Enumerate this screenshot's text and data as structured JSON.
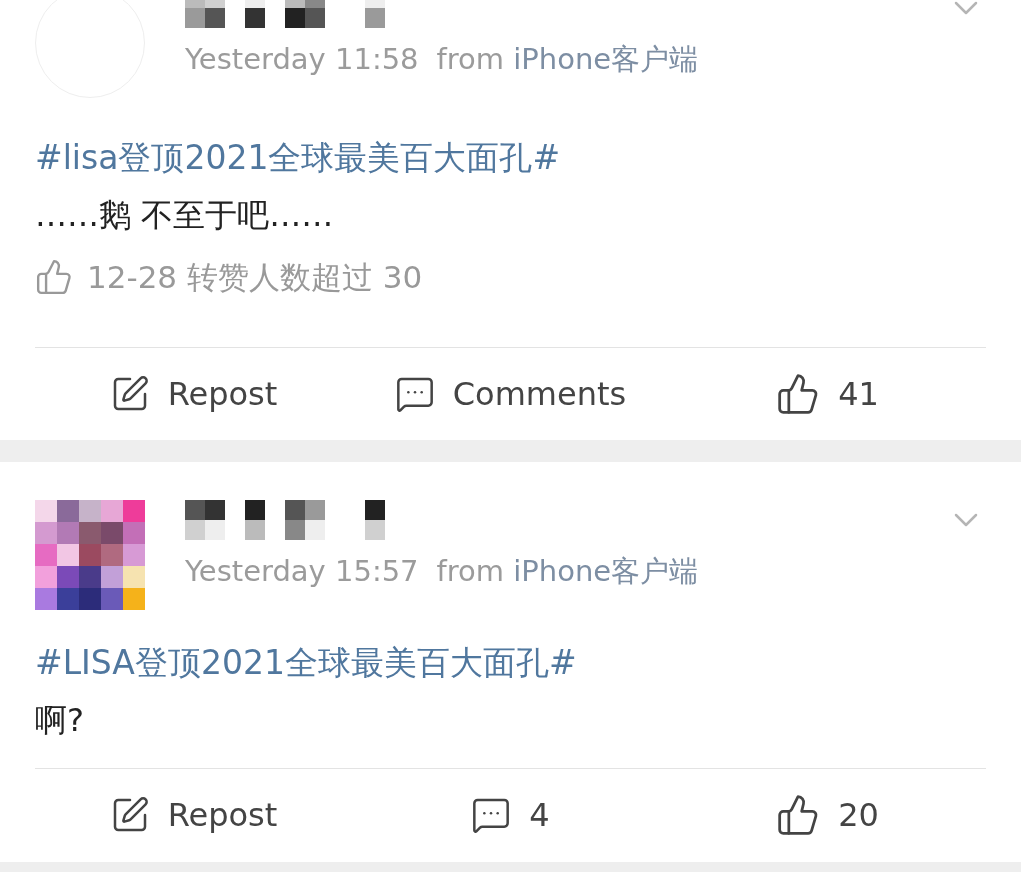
{
  "posts": [
    {
      "avatar": {
        "kind": "blank"
      },
      "time": "Yesterday 11:58",
      "source_prefix": "from",
      "source": "iPhone客户端",
      "hashtag": "#lisa登顶2021全球最美百大面孔#",
      "body": "……鹅 不至于吧……",
      "note": "12-28 转赞人数超过 30",
      "repost": "Repost",
      "comments": "Comments",
      "likes": "41"
    },
    {
      "avatar": {
        "kind": "pixelated"
      },
      "time": "Yesterday 15:57",
      "source_prefix": "from",
      "source": "iPhone客户端",
      "hashtag": "#LISA登顶2021全球最美百大面孔#",
      "body": "啊?",
      "repost": "Repost",
      "comments": "4",
      "likes": "20"
    }
  ]
}
